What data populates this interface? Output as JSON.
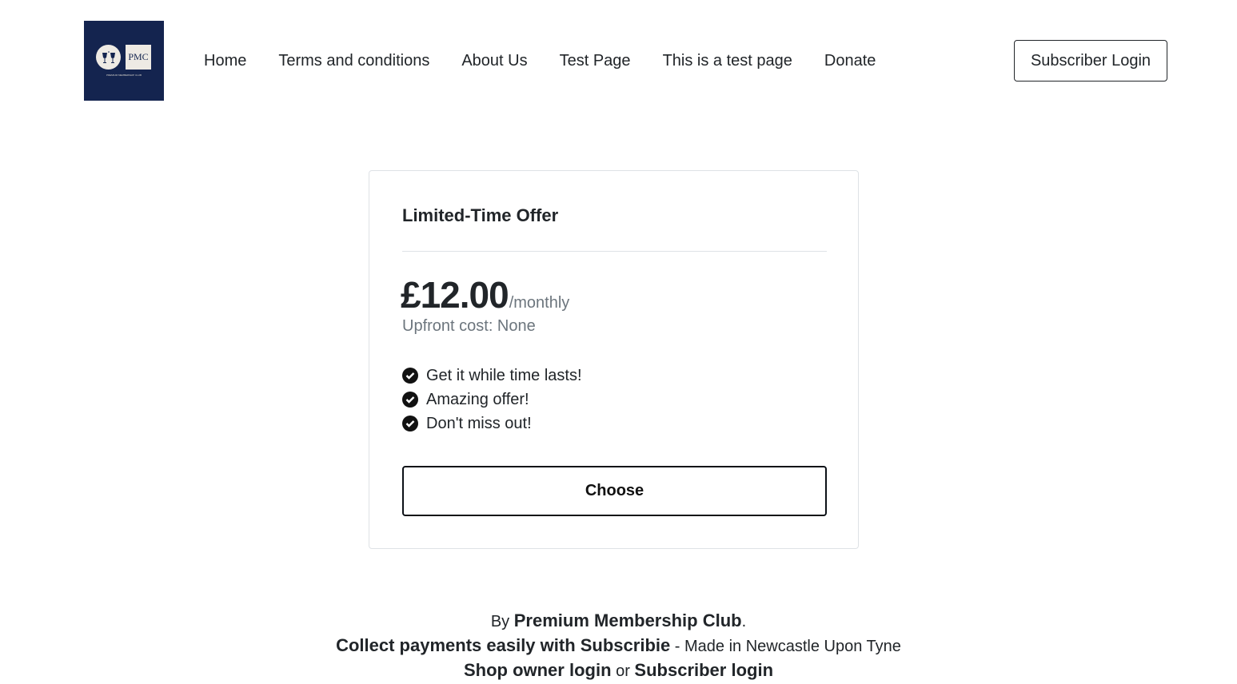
{
  "logo": {
    "text": "PMC",
    "tagline": "PREMIUM MEMBERSHIP CLUB",
    "icon": "toasting-glasses-icon",
    "background": "#14244f"
  },
  "nav": {
    "items": [
      {
        "label": "Home"
      },
      {
        "label": "Terms and conditions"
      },
      {
        "label": "About Us"
      },
      {
        "label": "Test Page"
      },
      {
        "label": "This is a test page"
      },
      {
        "label": "Donate"
      }
    ],
    "login_label": "Subscriber Login"
  },
  "plan": {
    "title": "Limited-Time Offer",
    "price": "£12.00",
    "period": "/monthly",
    "upfront": "Upfront cost: None",
    "features": [
      "Get it while time lasts!",
      "Amazing offer!",
      "Don't miss out!"
    ],
    "feature_icon": "check-circle-icon",
    "choose_label": "Choose"
  },
  "footer": {
    "by_prefix": "By",
    "shop_name": "Premium Membership Club",
    "by_suffix": ".",
    "collect_link": "Collect payments easily with Subscribie",
    "made_in": " - Made in Newcastle Upon Tyne",
    "shop_owner_login": "Shop owner login",
    "or": " or ",
    "subscriber_login": "Subscriber login"
  }
}
